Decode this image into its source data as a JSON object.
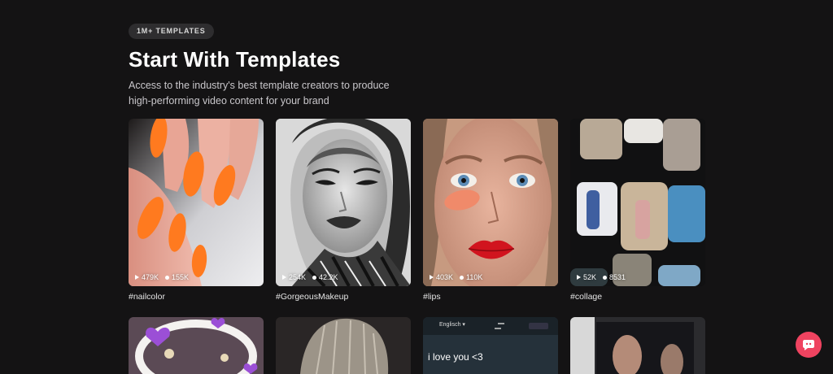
{
  "header": {
    "badge": "1M+ TEMPLATES",
    "title": "Start With Templates",
    "subtitle": "Access to the industry's best template creators to produce high-performing video content for your brand"
  },
  "templates": [
    {
      "tag": "#nailcolor",
      "plays": "479K",
      "uses": "155K"
    },
    {
      "tag": "#GorgeousMakeup",
      "plays": "254K",
      "uses": "42.2K"
    },
    {
      "tag": "#lips",
      "plays": "403K",
      "uses": "110K"
    },
    {
      "tag": "#collage",
      "plays": "52K",
      "uses": "8531"
    }
  ],
  "row2": {
    "translate_lang": "Englisch",
    "translate_text": "i love you <3"
  },
  "chat": {
    "icon": "chat-bubble-icon"
  },
  "colors": {
    "background": "#141314",
    "badge_bg": "#2e2d2f",
    "accent": "#ef4360"
  }
}
